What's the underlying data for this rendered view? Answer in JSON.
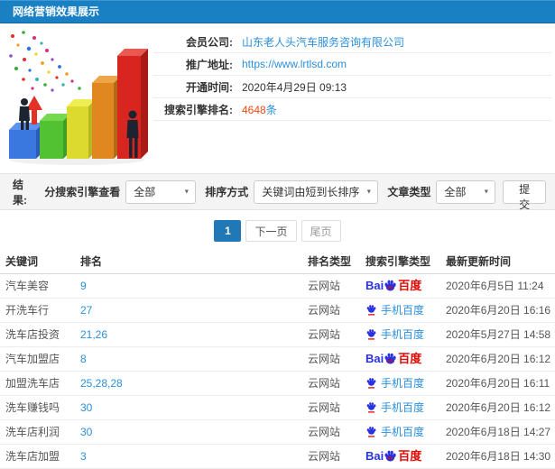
{
  "header": {
    "title": "网络营销效果展示"
  },
  "info": {
    "rows": [
      {
        "label": "会员公司:",
        "value": "山东老人头汽车服务咨询有限公司"
      },
      {
        "label": "推广地址:",
        "value": "https://www.lrtlsd.com"
      },
      {
        "label": "开通时间:",
        "value": "2020年4月29日 09:13"
      },
      {
        "label": "搜索引擎排名:",
        "value": "4648",
        "suffix": "条"
      }
    ]
  },
  "filters": {
    "result_label": "结果:",
    "engine_label": "分搜索引擎查看",
    "engine_value": "全部",
    "sort_label": "排序方式",
    "sort_value": "关键词由短到长排序",
    "article_label": "文章类型",
    "article_value": "全部",
    "submit_label": "提交"
  },
  "pagination": {
    "current": "1",
    "next": "下一页",
    "last": "尾页"
  },
  "table": {
    "headers": [
      "关键词",
      "排名",
      "排名类型",
      "搜索引擎类型",
      "最新更新时间"
    ],
    "rows": [
      {
        "keyword": "汽车美容",
        "rank": "9",
        "rank_type": "云网站",
        "engine": "baidu-pc",
        "updated": "2020年6月5日 11:24"
      },
      {
        "keyword": "开洗车行",
        "rank": "27",
        "rank_type": "云网站",
        "engine": "baidu-mobile",
        "updated": "2020年6月20日 16:16"
      },
      {
        "keyword": "洗车店投资",
        "rank": "21,26",
        "rank_type": "云网站",
        "engine": "baidu-mobile",
        "updated": "2020年5月27日 14:58"
      },
      {
        "keyword": "汽车加盟店",
        "rank": "8",
        "rank_type": "云网站",
        "engine": "baidu-pc",
        "updated": "2020年6月20日 16:12"
      },
      {
        "keyword": "加盟洗车店",
        "rank": "25,28,28",
        "rank_type": "云网站",
        "engine": "baidu-mobile",
        "updated": "2020年6月20日 16:11"
      },
      {
        "keyword": "洗车赚钱吗",
        "rank": "30",
        "rank_type": "云网站",
        "engine": "baidu-mobile",
        "updated": "2020年6月20日 16:12"
      },
      {
        "keyword": "洗车店利润",
        "rank": "30",
        "rank_type": "云网站",
        "engine": "baidu-mobile",
        "updated": "2020年6月18日 14:27"
      },
      {
        "keyword": "洗车店加盟",
        "rank": "3",
        "rank_type": "云网站",
        "engine": "baidu-pc",
        "updated": "2020年6月18日 14:30"
      }
    ]
  },
  "logos": {
    "baidu": {
      "bai": "Bai",
      "du": "du",
      "cn": "百度"
    },
    "mobile": "手机百度"
  },
  "colors": {
    "header_blue": "#1a80c4",
    "link_blue": "#2a8fdc",
    "highlight_red": "#f04a10",
    "baidu_blue": "#2932e1",
    "baidu_red": "#e10602",
    "pagination_active": "#2079b6"
  }
}
